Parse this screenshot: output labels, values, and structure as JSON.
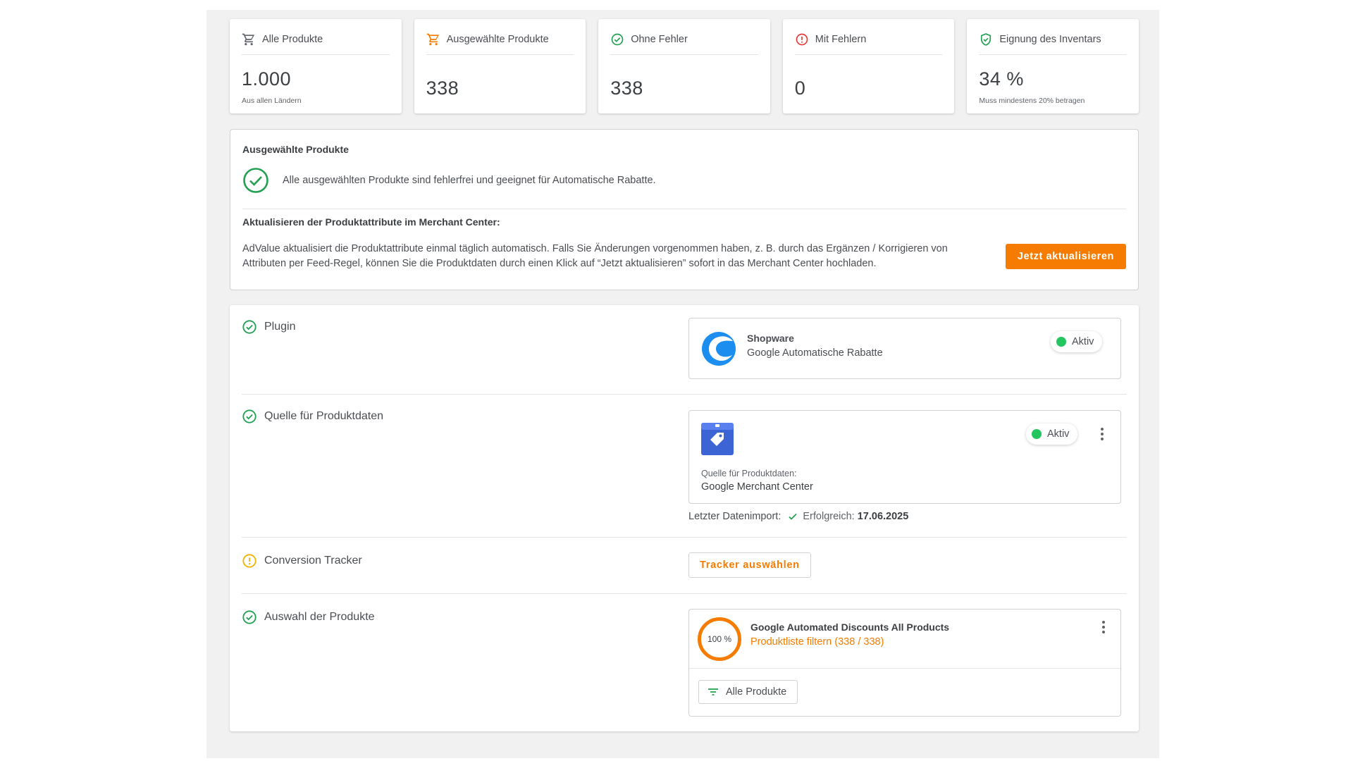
{
  "kpis": [
    {
      "label": "Alle Produkte",
      "value": "1.000",
      "sub": "Aus allen Ländern",
      "icon": "cart-icon",
      "color": "#5f6368"
    },
    {
      "label": "Ausgewählte Produkte",
      "value": "338",
      "sub": "",
      "icon": "cart-icon",
      "color": "#f57c00"
    },
    {
      "label": "Ohne Fehler",
      "value": "338",
      "sub": "",
      "icon": "check-circle-icon",
      "color": "#22a152"
    },
    {
      "label": "Mit Fehlern",
      "value": "0",
      "sub": "",
      "icon": "error-icon",
      "color": "#e53935"
    },
    {
      "label": "Eignung des Inventars",
      "value": "34 %",
      "sub": "Muss mindestens 20% betragen",
      "icon": "shield-check-icon",
      "color": "#22a152"
    }
  ],
  "selected": {
    "title": "Ausgewählte Produkte",
    "ok_text": "Alle ausgewählten Produkte sind fehlerfrei und geeignet für Automatische Rabatte.",
    "update_title": "Aktualisieren der Produktattribute im Merchant Center:",
    "update_desc": "AdValue aktualisiert die Produktattribute einmal täglich automatisch. Falls Sie Änderungen vorgenommen haben, z. B. durch das Ergänzen / Korrigieren von Attributen per Feed-Regel, können Sie die Produktdaten durch einen Klick auf “Jetzt aktualisieren” sofort in das Merchant Center hochladen.",
    "update_button": "Jetzt aktualisieren"
  },
  "steps": {
    "plugin": {
      "label": "Plugin",
      "status": "ok",
      "card_title": "Shopware",
      "card_subtitle": "Google Automatische Rabatte",
      "badge": "Aktiv"
    },
    "source": {
      "label": "Quelle für Produktdaten",
      "status": "ok",
      "card_caption": "Quelle für Produktdaten:",
      "card_value": "Google Merchant Center",
      "badge": "Aktiv",
      "import_label": "Letzter Datenimport:",
      "import_status": "Erfolgreich:",
      "import_date": "17.06.2025"
    },
    "tracker": {
      "label": "Conversion Tracker",
      "status": "warning",
      "button": "Tracker auswählen"
    },
    "products": {
      "label": "Auswahl der Produkte",
      "status": "ok",
      "percent_label": "100 %",
      "percent": 100,
      "list_title": "Google Automated Discounts All Products",
      "filter_link": "Produktliste filtern (338 / 338)",
      "chip": "Alle Produkte"
    }
  },
  "colors": {
    "accent": "#f57c00",
    "success": "#22a152",
    "active_dot": "#22c55e",
    "warning": "#f0b400",
    "error": "#e53935"
  }
}
